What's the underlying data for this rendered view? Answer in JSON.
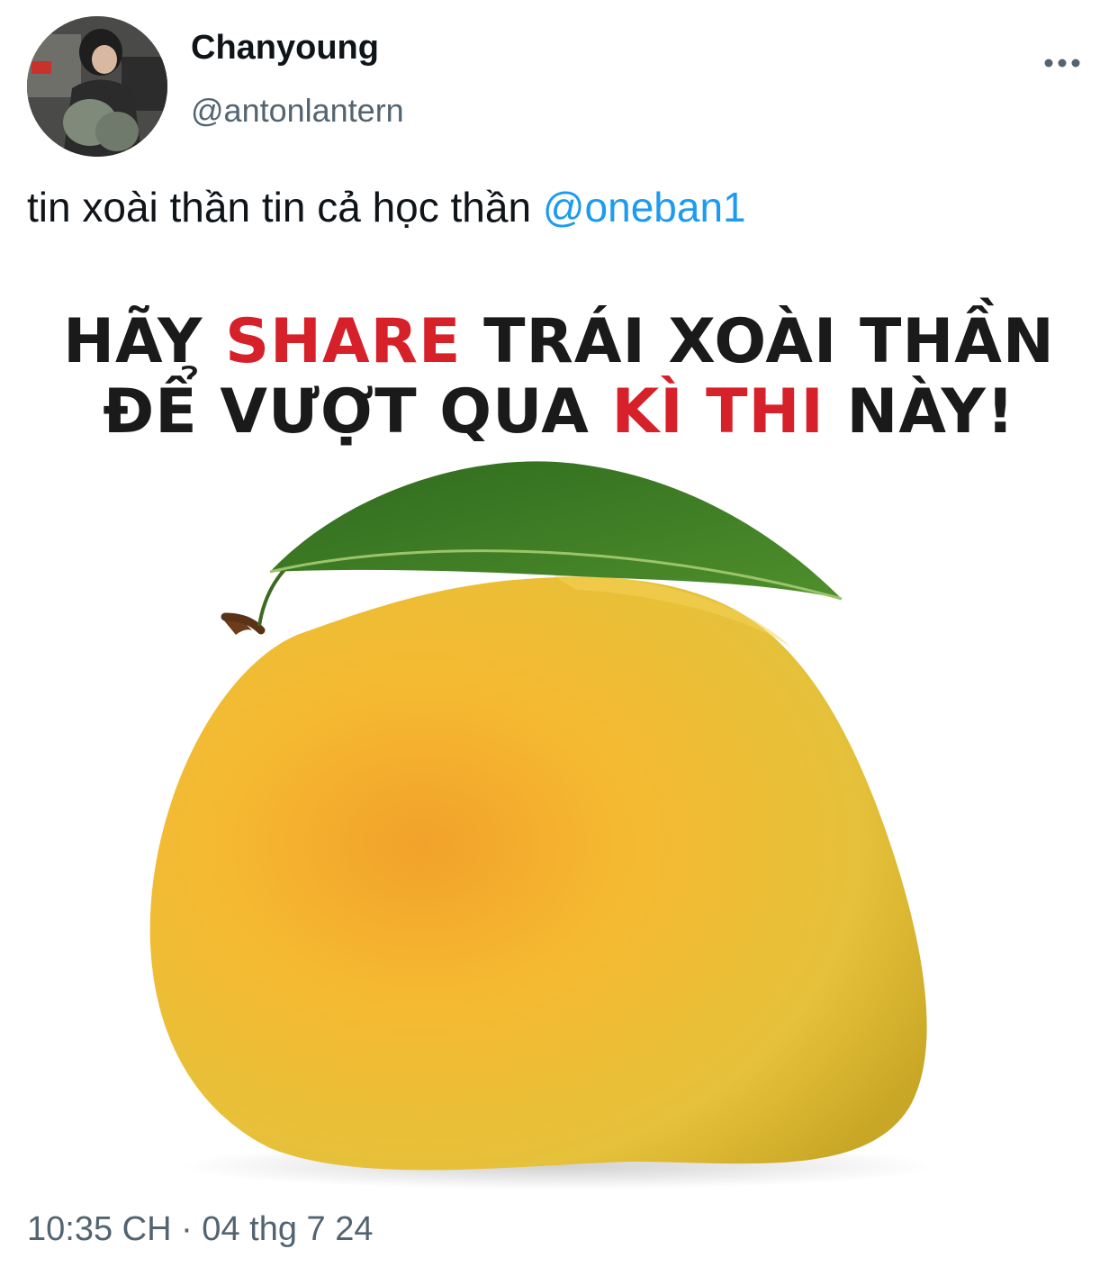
{
  "author": {
    "display_name": "Chanyoung",
    "handle": "@antonlantern",
    "avatar_icon": "profile-photo"
  },
  "more_icon": "more-horizontal-icon",
  "tweet": {
    "text": "tin xoài thần tin cả học thần ",
    "mention": "@oneban1"
  },
  "meme": {
    "line1": {
      "a": "HÃY ",
      "b": "SHARE",
      "c": " TRÁI XOÀI THẦN"
    },
    "line2": {
      "a": "ĐỂ VƯỢT QUA ",
      "b": "KÌ THI",
      "c": " NÀY!"
    },
    "accent_color": "#d6202a"
  },
  "timestamp": "10:35 CH · 04 thg 7 24",
  "colors": {
    "mention": "#1d9bf0",
    "secondary_text": "#536471",
    "primary_text": "#0f1419"
  }
}
